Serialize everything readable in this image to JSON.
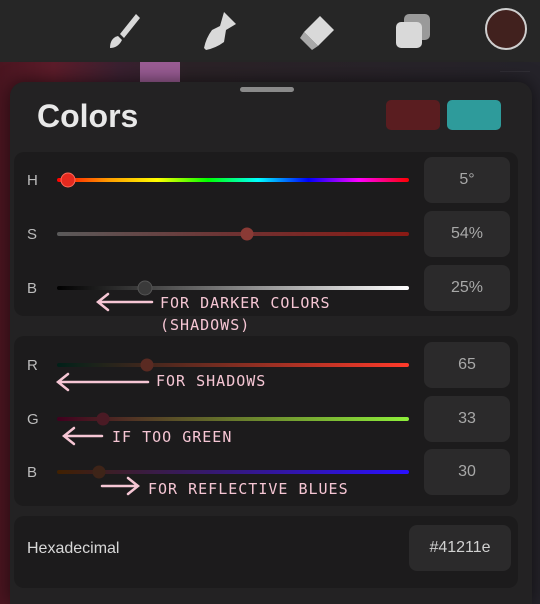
{
  "toolbar": {
    "tools": [
      {
        "icon": "brush-icon"
      },
      {
        "icon": "smudge-icon"
      },
      {
        "icon": "eraser-icon"
      },
      {
        "icon": "layers-icon"
      }
    ],
    "current_color": "#41211e"
  },
  "panel": {
    "title": "Colors",
    "primary_color": "#5a1d20",
    "secondary_color": "#2e9b9b"
  },
  "hsb": {
    "h": {
      "label": "H",
      "value": "5°",
      "fraction": 0.03
    },
    "s": {
      "label": "S",
      "value": "54%",
      "fraction": 0.54
    },
    "b": {
      "label": "B",
      "value": "25%",
      "fraction": 0.25
    }
  },
  "rgb": {
    "r": {
      "label": "R",
      "value": "65",
      "fraction": 0.255
    },
    "g": {
      "label": "G",
      "value": "33",
      "fraction": 0.13
    },
    "b": {
      "label": "B",
      "value": "30",
      "fraction": 0.118
    }
  },
  "hex": {
    "label": "Hexadecimal",
    "value": "#41211e"
  },
  "annotations": {
    "darker": "FOR DARKER COLORS",
    "shadows_paren": "(SHADOWS)",
    "shadows": "FOR SHADOWS",
    "green": "IF TOO GREEN",
    "blues": "FOR REFLECTIVE BLUES"
  }
}
